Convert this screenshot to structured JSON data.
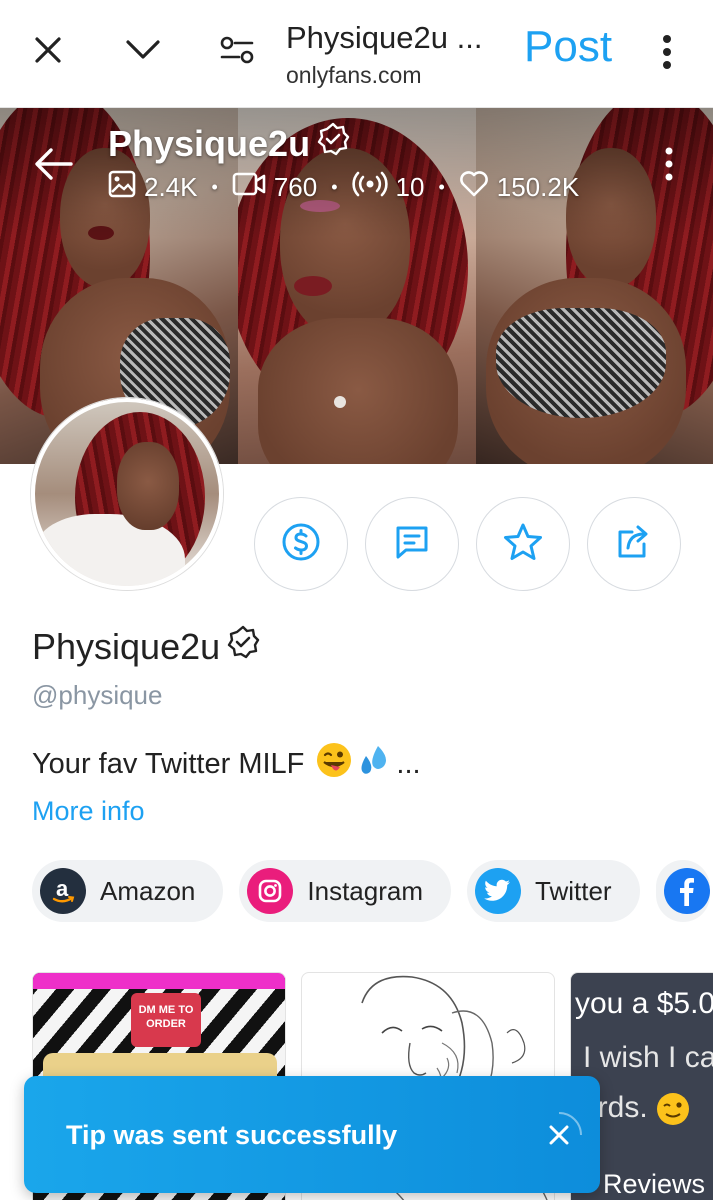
{
  "browser": {
    "title": "Physique2u ...",
    "domain": "onlyfans.com",
    "post_label": "Post",
    "accent": "#1da1f2"
  },
  "cover": {
    "name": "Physique2u",
    "stats": {
      "photos": "2.4K",
      "videos": "760",
      "streams": "10",
      "likes": "150.2K"
    }
  },
  "profile": {
    "name": "Physique2u",
    "handle": "@physique",
    "bio": "Your fav Twitter MILF",
    "bio_suffix": "...",
    "more_info": "More info"
  },
  "actions": [
    "tip",
    "message",
    "favorite",
    "share"
  ],
  "social_links": [
    {
      "label": "Amazon",
      "icon": "amazon-icon"
    },
    {
      "label": "Instagram",
      "icon": "instagram-icon"
    },
    {
      "label": "Twitter",
      "icon": "twitter-icon"
    },
    {
      "label": "",
      "icon": "facebook-icon"
    }
  ],
  "highlights": {
    "card1_tag": "DM ME TO ORDER",
    "card3_line1": "you a $5.0",
    "card3_line2": "I wish I ca",
    "card3_line3": "ards.",
    "card3_label": "Reviews"
  },
  "toast": {
    "message": "Tip was sent successfully",
    "color": "#1aa6eb"
  }
}
